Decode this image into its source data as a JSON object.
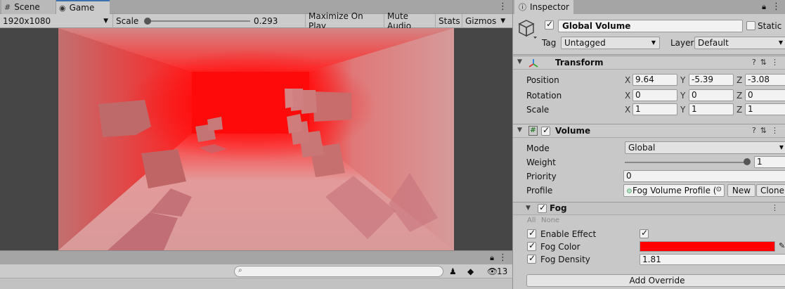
{
  "game_view": {
    "tabs": [
      {
        "label": "Scene",
        "icon": "grid-icon",
        "active": false
      },
      {
        "label": "Game",
        "icon": "gamepad-icon",
        "active": true
      }
    ],
    "resolution": "1920x1080",
    "scale_label": "Scale",
    "scale_value": "0.293",
    "scale_fraction": 0.0,
    "toolbar_buttons": {
      "maximize": "Maximize On Play",
      "mute": "Mute Audio",
      "stats": "Stats",
      "gizmos": "Gizmos"
    },
    "fog_tint": "#ff0000"
  },
  "console": {
    "search_placeholder": "",
    "hidden_count": "13"
  },
  "inspector": {
    "tab_label": "Inspector",
    "gameobject": {
      "active": true,
      "name": "Global Volume",
      "static_label": "Static",
      "static_checked": false,
      "tag_label": "Tag",
      "tag_value": "Untagged",
      "layer_label": "Layer",
      "layer_value": "Default"
    },
    "transform": {
      "title": "Transform",
      "rows": [
        {
          "label": "Position",
          "x": "9.64",
          "y": "-5.39",
          "z": "-3.08"
        },
        {
          "label": "Rotation",
          "x": "0",
          "y": "0",
          "z": "0"
        },
        {
          "label": "Scale",
          "x": "1",
          "y": "1",
          "z": "1"
        }
      ],
      "axis_labels": [
        "X",
        "Y",
        "Z"
      ]
    },
    "volume": {
      "title": "Volume",
      "enabled": true,
      "mode_label": "Mode",
      "mode_value": "Global",
      "weight_label": "Weight",
      "weight_value": "1",
      "priority_label": "Priority",
      "priority_value": "0",
      "profile_label": "Profile",
      "profile_value": "Fog Volume Profile (",
      "new_label": "New",
      "clone_label": "Clone"
    },
    "fog": {
      "title": "Fog",
      "enabled": true,
      "all_label": "All",
      "none_label": "None",
      "enable_effect_label": "Enable Effect",
      "enable_effect_checked": true,
      "color_label": "Fog Color",
      "color_value": "#ff0000",
      "density_label": "Fog Density",
      "density_value": "1.81"
    },
    "add_override_label": "Add Override"
  }
}
